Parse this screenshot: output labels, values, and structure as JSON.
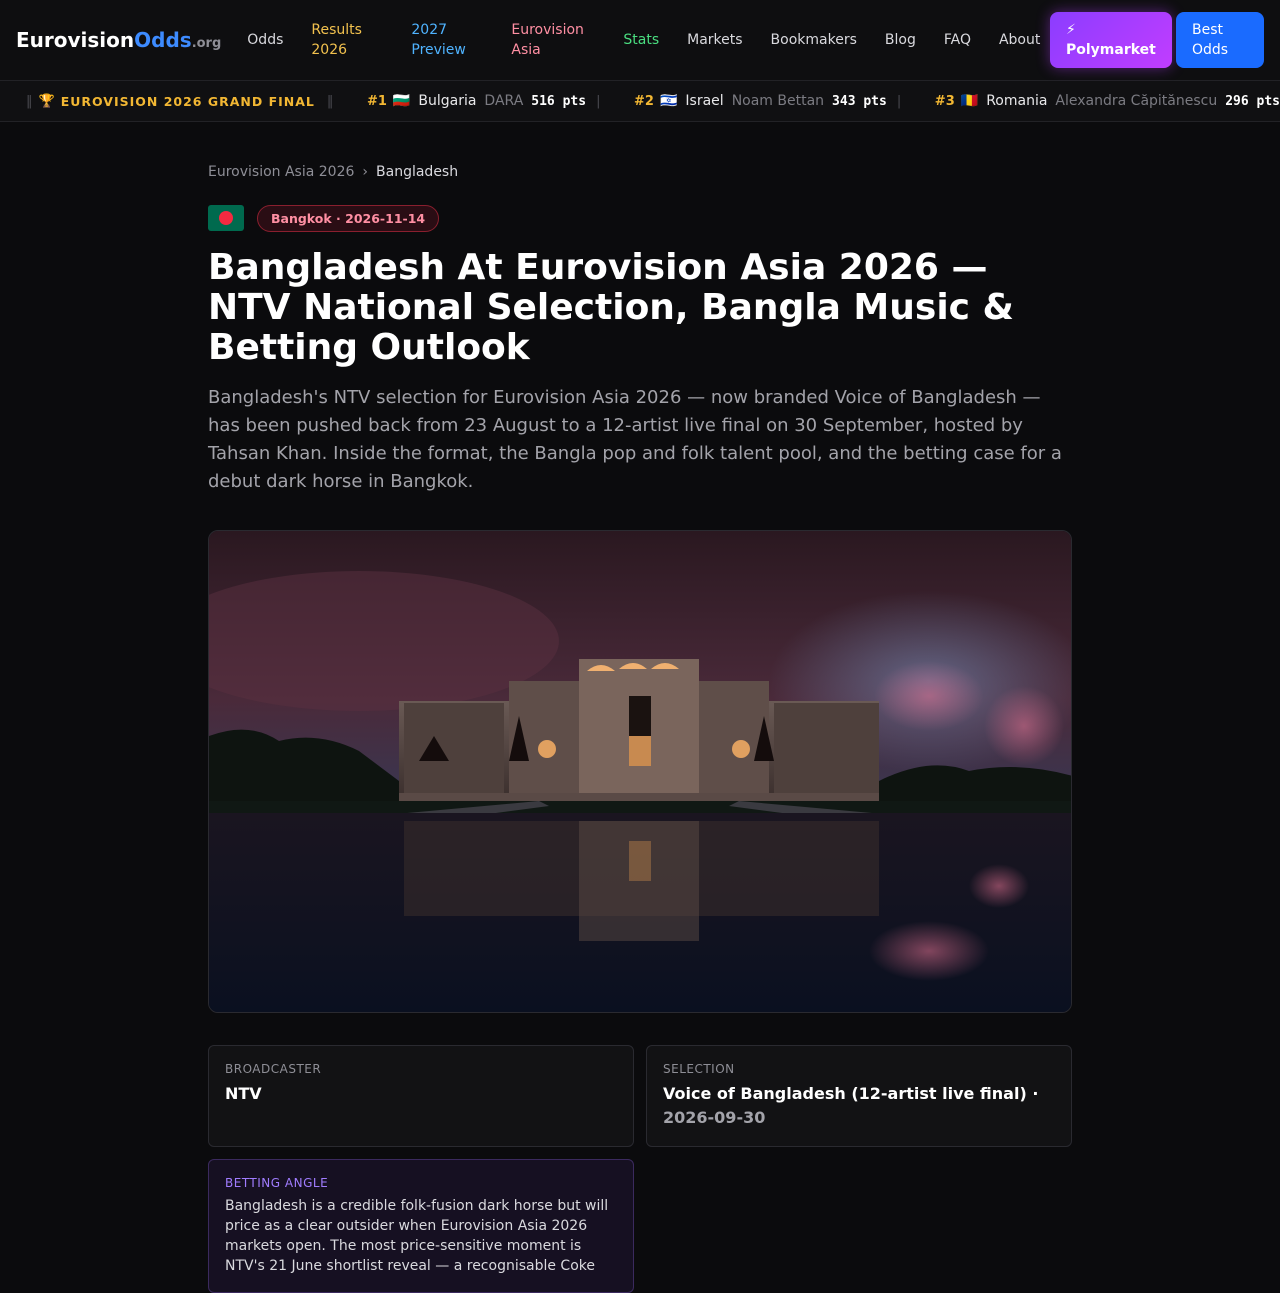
{
  "header": {
    "logo": {
      "part1": "Eurovision",
      "part2": "Odds",
      "part3": ".org"
    },
    "nav": [
      {
        "label": "Odds",
        "color": "#d9d9de"
      },
      {
        "label": "Results 2026",
        "color": "#f2c14e"
      },
      {
        "label": "2027 Preview",
        "color": "#4fb3ff"
      },
      {
        "label": "Eurovision Asia",
        "color": "#ff8fa3"
      },
      {
        "label": "Stats",
        "color": "#4ade80"
      },
      {
        "label": "Markets",
        "color": "#d9d9de"
      },
      {
        "label": "Bookmakers",
        "color": "#d9d9de"
      },
      {
        "label": "Blog",
        "color": "#d9d9de"
      },
      {
        "label": "FAQ",
        "color": "#d9d9de"
      },
      {
        "label": "About",
        "color": "#d9d9de"
      }
    ],
    "polymarket_icon": "lightning-icon",
    "polymarket_label": "⚡ Polymarket",
    "best_odds_label": "Best Odds"
  },
  "ticker": {
    "trophy": "🏆",
    "headline": "EUROVISION 2026 GRAND FINAL",
    "entries": [
      {
        "rank": "#1",
        "flag": "🇧🇬",
        "country": "Bulgaria",
        "artist": "DARA",
        "points": "516 pts"
      },
      {
        "rank": "#2",
        "flag": "🇮🇱",
        "country": "Israel",
        "artist": "Noam Bettan",
        "points": "343 pts"
      },
      {
        "rank": "#3",
        "flag": "🇷🇴",
        "country": "Romania",
        "artist": "Alexandra Căpitănescu",
        "points": "296 pts"
      }
    ]
  },
  "breadcrumb": {
    "parent": "Eurovision Asia 2026",
    "separator": "›",
    "current": "Bangladesh"
  },
  "meta": {
    "flag_icon": "bangladesh-flag-icon",
    "pill": "Bangkok · 2026-11-14"
  },
  "article": {
    "title": "Bangladesh At Eurovision Asia 2026 — NTV National Selection, Bangla Music & Betting Outlook",
    "lede": "Bangladesh's NTV selection for Eurovision Asia 2026 — now branded Voice of Bangladesh — has been pushed back from 23 August to a 12-artist live final on 30 September, hosted by Tahsan Khan. Inside the format, the Bangla pop and folk talent pool, and the betting case for a debut dark horse in Bangkok."
  },
  "cards": {
    "broadcaster": {
      "label": "BROADCASTER",
      "value": "NTV"
    },
    "selection": {
      "label": "SELECTION",
      "value": "Voice of Bangladesh (12-artist live final) · ",
      "date": "2026-09-30"
    },
    "betting": {
      "label": "BETTING ANGLE",
      "text": "Bangladesh is a credible folk-fusion dark horse but will price as a clear outsider when Eurovision Asia 2026 markets open. The most price-sensitive moment is NTV's 21 June shortlist reveal — a recognisable Coke"
    }
  }
}
